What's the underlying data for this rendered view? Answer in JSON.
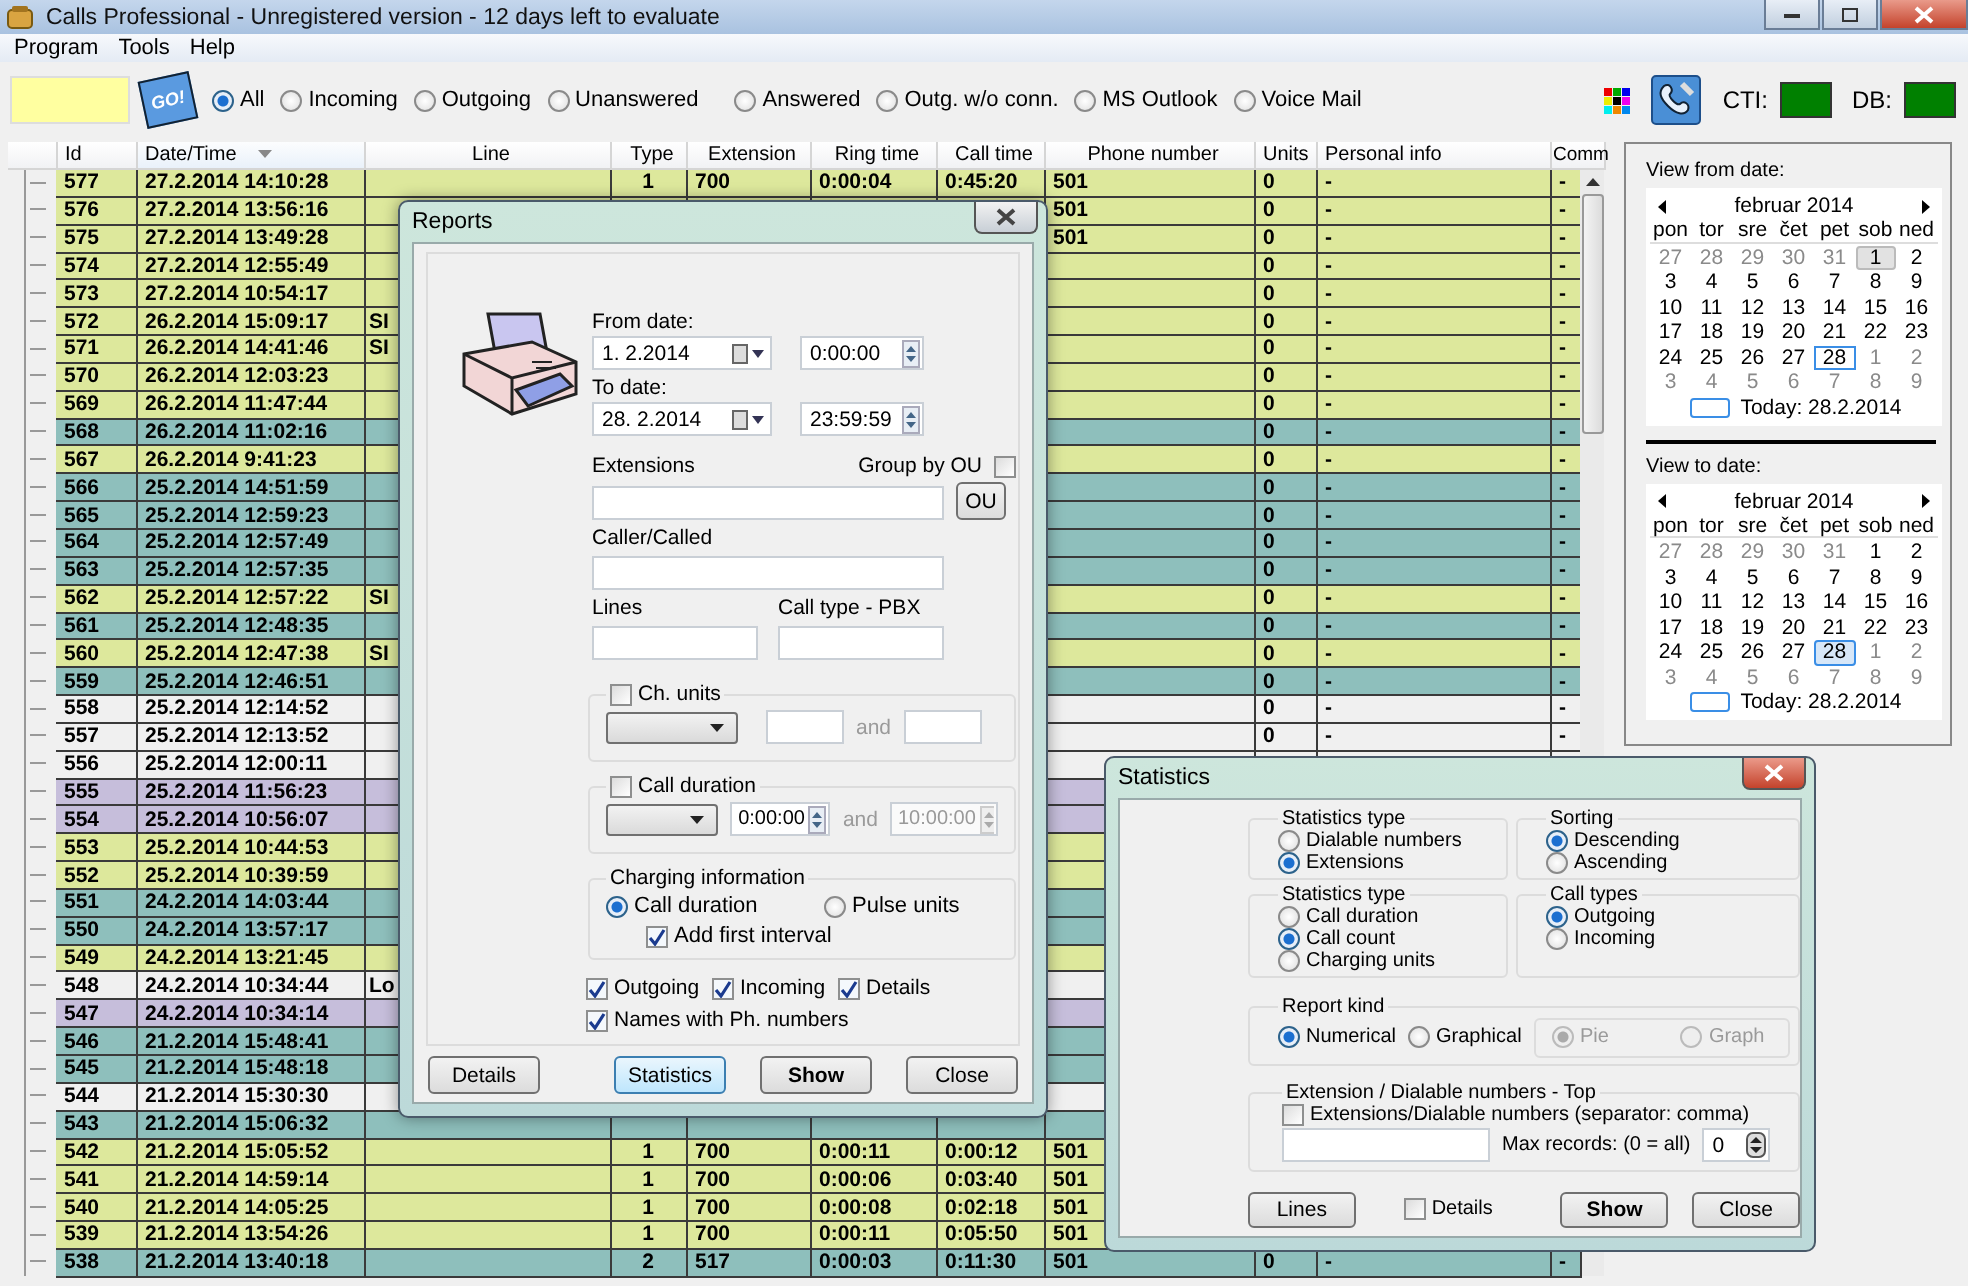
{
  "window": {
    "title": "Calls Professional - Unregistered version - 12 days left to evaluate"
  },
  "menu": [
    "Program",
    "Tools",
    "Help"
  ],
  "toolbar": {
    "go_button": "GO!",
    "filters": [
      {
        "label": "All",
        "selected": true
      },
      {
        "label": "Incoming",
        "selected": false
      },
      {
        "label": "Outgoing",
        "selected": false
      },
      {
        "label": "Unanswered",
        "selected": false
      },
      {
        "label": "Answered",
        "selected": false
      },
      {
        "label": "Outg. w/o conn.",
        "selected": false
      },
      {
        "label": "MS Outlook",
        "selected": false
      },
      {
        "label": "Voice Mail",
        "selected": false
      }
    ],
    "status": [
      {
        "label": "CTI:",
        "color": "#008000"
      },
      {
        "label": "DB:",
        "color": "#008000"
      }
    ]
  },
  "table": {
    "columns": [
      {
        "label": "Id",
        "sorted": false
      },
      {
        "label": "Date/Time",
        "sorted": true
      },
      {
        "label": "Line",
        "sorted": false
      },
      {
        "label": "Type",
        "sorted": false
      },
      {
        "label": "Extension",
        "sorted": false
      },
      {
        "label": "Ring time",
        "sorted": false
      },
      {
        "label": "Call time",
        "sorted": false
      },
      {
        "label": "Phone number",
        "sorted": false
      },
      {
        "label": "Units",
        "sorted": false
      },
      {
        "label": "Personal info",
        "sorted": false
      },
      {
        "label": "Comm",
        "sorted": false
      }
    ],
    "rows": [
      {
        "color": "#dde89c",
        "id": "577",
        "datetime": "27.2.2014 14:10:28",
        "type": "1",
        "extension": "700",
        "ring_time": "0:00:04",
        "call_time": "0:45:20",
        "phone_number": "501",
        "units": "0",
        "personal_info": "-",
        "comment": "-"
      },
      {
        "color": "#dde89c",
        "id": "576",
        "datetime": "27.2.2014 13:56:16",
        "phone_number": "501",
        "units": "0",
        "personal_info": "-",
        "comment": "-"
      },
      {
        "color": "#dde89c",
        "id": "575",
        "datetime": "27.2.2014 13:49:28",
        "phone_number": "501",
        "units": "0",
        "personal_info": "-",
        "comment": "-"
      },
      {
        "color": "#dde89c",
        "id": "574",
        "datetime": "27.2.2014 12:55:49",
        "units": "0",
        "personal_info": "-",
        "comment": "-"
      },
      {
        "color": "#dde89c",
        "id": "573",
        "datetime": "27.2.2014 10:54:17",
        "units": "0",
        "personal_info": "-",
        "comment": "-"
      },
      {
        "color": "#dde89c",
        "id": "572",
        "datetime": "26.2.2014 15:09:17",
        "line": "SI",
        "units": "0",
        "personal_info": "-",
        "comment": "-"
      },
      {
        "color": "#dde89c",
        "id": "571",
        "datetime": "26.2.2014 14:41:46",
        "line": "SI",
        "units": "0",
        "personal_info": "-",
        "comment": "-"
      },
      {
        "color": "#dde89c",
        "id": "570",
        "datetime": "26.2.2014 12:03:23",
        "units": "0",
        "personal_info": "-",
        "comment": "-"
      },
      {
        "color": "#dde89c",
        "id": "569",
        "datetime": "26.2.2014 11:47:44",
        "units": "0",
        "personal_info": "-",
        "comment": "-"
      },
      {
        "color": "#8ebfbc",
        "id": "568",
        "datetime": "26.2.2014 11:02:16",
        "units": "0",
        "personal_info": "-",
        "comment": "-"
      },
      {
        "color": "#dde89c",
        "id": "567",
        "datetime": "26.2.2014 9:41:23",
        "units": "0",
        "personal_info": "-",
        "comment": "-"
      },
      {
        "color": "#8ebfbc",
        "id": "566",
        "datetime": "25.2.2014 14:51:59",
        "units": "0",
        "personal_info": "-",
        "comment": "-"
      },
      {
        "color": "#8ebfbc",
        "id": "565",
        "datetime": "25.2.2014 12:59:23",
        "units": "0",
        "personal_info": "-",
        "comment": "-"
      },
      {
        "color": "#8ebfbc",
        "id": "564",
        "datetime": "25.2.2014 12:57:49",
        "units": "0",
        "personal_info": "-",
        "comment": "-"
      },
      {
        "color": "#8ebfbc",
        "id": "563",
        "datetime": "25.2.2014 12:57:35",
        "units": "0",
        "personal_info": "-",
        "comment": "-"
      },
      {
        "color": "#dde89c",
        "id": "562",
        "datetime": "25.2.2014 12:57:22",
        "line": "SI",
        "units": "0",
        "personal_info": "-",
        "comment": "-"
      },
      {
        "color": "#8ebfbc",
        "id": "561",
        "datetime": "25.2.2014 12:48:35",
        "units": "0",
        "personal_info": "-",
        "comment": "-"
      },
      {
        "color": "#dde89c",
        "id": "560",
        "datetime": "25.2.2014 12:47:38",
        "line": "SI",
        "units": "0",
        "personal_info": "-",
        "comment": "-"
      },
      {
        "color": "#8ebfbc",
        "id": "559",
        "datetime": "25.2.2014 12:46:51",
        "units": "0",
        "personal_info": "-",
        "comment": "-"
      },
      {
        "color": "#f0f0f0",
        "id": "558",
        "datetime": "25.2.2014 12:14:52",
        "units": "0",
        "personal_info": "-",
        "comment": "-"
      },
      {
        "color": "#f0f0f0",
        "id": "557",
        "datetime": "25.2.2014 12:13:52",
        "units": "0",
        "personal_info": "-",
        "comment": "-"
      },
      {
        "color": "#f0f0f0",
        "id": "556",
        "datetime": "25.2.2014 12:00:11"
      },
      {
        "color": "#c6bedb",
        "id": "555",
        "datetime": "25.2.2014 11:56:23"
      },
      {
        "color": "#c6bedb",
        "id": "554",
        "datetime": "25.2.2014 10:56:07"
      },
      {
        "color": "#dde89c",
        "id": "553",
        "datetime": "25.2.2014 10:44:53"
      },
      {
        "color": "#dde89c",
        "id": "552",
        "datetime": "25.2.2014 10:39:59"
      },
      {
        "color": "#8ebfbc",
        "id": "551",
        "datetime": "24.2.2014 14:03:44"
      },
      {
        "color": "#8ebfbc",
        "id": "550",
        "datetime": "24.2.2014 13:57:17"
      },
      {
        "color": "#dde89c",
        "id": "549",
        "datetime": "24.2.2014 13:21:45"
      },
      {
        "color": "#f0f0f0",
        "id": "548",
        "datetime": "24.2.2014 10:34:44",
        "line": "Lo"
      },
      {
        "color": "#c6bedb",
        "id": "547",
        "datetime": "24.2.2014 10:34:14"
      },
      {
        "color": "#8ebfbc",
        "id": "546",
        "datetime": "21.2.2014 15:48:41"
      },
      {
        "color": "#8ebfbc",
        "id": "545",
        "datetime": "21.2.2014 15:48:18"
      },
      {
        "color": "#f0f0f0",
        "id": "544",
        "datetime": "21.2.2014 15:30:30"
      },
      {
        "color": "#8ebfbc",
        "id": "543",
        "datetime": "21.2.2014 15:06:32"
      },
      {
        "color": "#dde89c",
        "id": "542",
        "datetime": "21.2.2014 15:05:52",
        "type": "1",
        "extension": "700",
        "ring_time": "0:00:11",
        "call_time": "0:00:12",
        "phone_number": "501"
      },
      {
        "color": "#dde89c",
        "id": "541",
        "datetime": "21.2.2014 14:59:14",
        "type": "1",
        "extension": "700",
        "ring_time": "0:00:06",
        "call_time": "0:03:40",
        "phone_number": "501"
      },
      {
        "color": "#dde89c",
        "id": "540",
        "datetime": "21.2.2014 14:05:25",
        "type": "1",
        "extension": "700",
        "ring_time": "0:00:08",
        "call_time": "0:02:18",
        "phone_number": "501"
      },
      {
        "color": "#dde89c",
        "id": "539",
        "datetime": "21.2.2014 13:54:26",
        "type": "1",
        "extension": "700",
        "ring_time": "0:00:11",
        "call_time": "0:05:50",
        "phone_number": "501"
      },
      {
        "color": "#8ebfbc",
        "id": "538",
        "datetime": "21.2.2014 13:40:18",
        "type": "2",
        "extension": "517",
        "ring_time": "0:00:03",
        "call_time": "0:11:30",
        "phone_number": "501",
        "units": "0",
        "personal_info": "-",
        "comment": "-"
      }
    ]
  },
  "calendars": [
    {
      "title": "View from date:",
      "month": "februar 2014",
      "weekdays": [
        "pon",
        "tor",
        "sre",
        "čet",
        "pet",
        "sob",
        "ned"
      ],
      "today_label": "Today: 28.2.2014",
      "weeks": [
        [
          {
            "day": "27",
            "outside": true,
            "selected": false,
            "today": false
          },
          {
            "day": "28",
            "outside": true,
            "selected": false,
            "today": false
          },
          {
            "day": "29",
            "outside": true,
            "selected": false,
            "today": false
          },
          {
            "day": "30",
            "outside": true,
            "selected": false,
            "today": false
          },
          {
            "day": "31",
            "outside": true,
            "selected": false,
            "today": false
          },
          {
            "day": "1",
            "outside": false,
            "selected": true,
            "today": false
          },
          {
            "day": "2",
            "outside": false,
            "selected": false,
            "today": false
          }
        ],
        [
          {
            "day": "3",
            "outside": false,
            "selected": false,
            "today": false
          },
          {
            "day": "4",
            "outside": false,
            "selected": false,
            "today": false
          },
          {
            "day": "5",
            "outside": false,
            "selected": false,
            "today": false
          },
          {
            "day": "6",
            "outside": false,
            "selected": false,
            "today": false
          },
          {
            "day": "7",
            "outside": false,
            "selected": false,
            "today": false
          },
          {
            "day": "8",
            "outside": false,
            "selected": false,
            "today": false
          },
          {
            "day": "9",
            "outside": false,
            "selected": false,
            "today": false
          }
        ],
        [
          {
            "day": "10",
            "outside": false,
            "selected": false,
            "today": false
          },
          {
            "day": "11",
            "outside": false,
            "selected": false,
            "today": false
          },
          {
            "day": "12",
            "outside": false,
            "selected": false,
            "today": false
          },
          {
            "day": "13",
            "outside": false,
            "selected": false,
            "today": false
          },
          {
            "day": "14",
            "outside": false,
            "selected": false,
            "today": false
          },
          {
            "day": "15",
            "outside": false,
            "selected": false,
            "today": false
          },
          {
            "day": "16",
            "outside": false,
            "selected": false,
            "today": false
          }
        ],
        [
          {
            "day": "17",
            "outside": false,
            "selected": false,
            "today": false
          },
          {
            "day": "18",
            "outside": false,
            "selected": false,
            "today": false
          },
          {
            "day": "19",
            "outside": false,
            "selected": false,
            "today": false
          },
          {
            "day": "20",
            "outside": false,
            "selected": false,
            "today": false
          },
          {
            "day": "21",
            "outside": false,
            "selected": false,
            "today": false
          },
          {
            "day": "22",
            "outside": false,
            "selected": false,
            "today": false
          },
          {
            "day": "23",
            "outside": false,
            "selected": false,
            "today": false
          }
        ],
        [
          {
            "day": "24",
            "outside": false,
            "selected": false,
            "today": false
          },
          {
            "day": "25",
            "outside": false,
            "selected": false,
            "today": false
          },
          {
            "day": "26",
            "outside": false,
            "selected": false,
            "today": false
          },
          {
            "day": "27",
            "outside": false,
            "selected": false,
            "today": false
          },
          {
            "day": "28",
            "outside": false,
            "selected": false,
            "today": true
          },
          {
            "day": "1",
            "outside": true,
            "selected": false,
            "today": false
          },
          {
            "day": "2",
            "outside": true,
            "selected": false,
            "today": false
          }
        ],
        [
          {
            "day": "3",
            "outside": true,
            "selected": false,
            "today": false
          },
          {
            "day": "4",
            "outside": true,
            "selected": false,
            "today": false
          },
          {
            "day": "5",
            "outside": true,
            "selected": false,
            "today": false
          },
          {
            "day": "6",
            "outside": true,
            "selected": false,
            "today": false
          },
          {
            "day": "7",
            "outside": true,
            "selected": false,
            "today": false
          },
          {
            "day": "8",
            "outside": true,
            "selected": false,
            "today": false
          },
          {
            "day": "9",
            "outside": true,
            "selected": false,
            "today": false
          }
        ]
      ]
    },
    {
      "title": "View to date:",
      "month": "februar 2014",
      "weekdays": [
        "pon",
        "tor",
        "sre",
        "čet",
        "pet",
        "sob",
        "ned"
      ],
      "today_label": "Today: 28.2.2014",
      "weeks": [
        [
          {
            "day": "27",
            "outside": true,
            "selected": false,
            "today": false
          },
          {
            "day": "28",
            "outside": true,
            "selected": false,
            "today": false
          },
          {
            "day": "29",
            "outside": true,
            "selected": false,
            "today": false
          },
          {
            "day": "30",
            "outside": true,
            "selected": false,
            "today": false
          },
          {
            "day": "31",
            "outside": true,
            "selected": false,
            "today": false
          },
          {
            "day": "1",
            "outside": false,
            "selected": false,
            "today": false
          },
          {
            "day": "2",
            "outside": false,
            "selected": false,
            "today": false
          }
        ],
        [
          {
            "day": "3",
            "outside": false,
            "selected": false,
            "today": false
          },
          {
            "day": "4",
            "outside": false,
            "selected": false,
            "today": false
          },
          {
            "day": "5",
            "outside": false,
            "selected": false,
            "today": false
          },
          {
            "day": "6",
            "outside": false,
            "selected": false,
            "today": false
          },
          {
            "day": "7",
            "outside": false,
            "selected": false,
            "today": false
          },
          {
            "day": "8",
            "outside": false,
            "selected": false,
            "today": false
          },
          {
            "day": "9",
            "outside": false,
            "selected": false,
            "today": false
          }
        ],
        [
          {
            "day": "10",
            "outside": false,
            "selected": false,
            "today": false
          },
          {
            "day": "11",
            "outside": false,
            "selected": false,
            "today": false
          },
          {
            "day": "12",
            "outside": false,
            "selected": false,
            "today": false
          },
          {
            "day": "13",
            "outside": false,
            "selected": false,
            "today": false
          },
          {
            "day": "14",
            "outside": false,
            "selected": false,
            "today": false
          },
          {
            "day": "15",
            "outside": false,
            "selected": false,
            "today": false
          },
          {
            "day": "16",
            "outside": false,
            "selected": false,
            "today": false
          }
        ],
        [
          {
            "day": "17",
            "outside": false,
            "selected": false,
            "today": false
          },
          {
            "day": "18",
            "outside": false,
            "selected": false,
            "today": false
          },
          {
            "day": "19",
            "outside": false,
            "selected": false,
            "today": false
          },
          {
            "day": "20",
            "outside": false,
            "selected": false,
            "today": false
          },
          {
            "day": "21",
            "outside": false,
            "selected": false,
            "today": false
          },
          {
            "day": "22",
            "outside": false,
            "selected": false,
            "today": false
          },
          {
            "day": "23",
            "outside": false,
            "selected": false,
            "today": false
          }
        ],
        [
          {
            "day": "24",
            "outside": false,
            "selected": false,
            "today": false
          },
          {
            "day": "25",
            "outside": false,
            "selected": false,
            "today": false
          },
          {
            "day": "26",
            "outside": false,
            "selected": false,
            "today": false
          },
          {
            "day": "27",
            "outside": false,
            "selected": false,
            "today": false
          },
          {
            "day": "28",
            "outside": false,
            "selected": true,
            "today": true
          },
          {
            "day": "1",
            "outside": true,
            "selected": false,
            "today": false
          },
          {
            "day": "2",
            "outside": true,
            "selected": false,
            "today": false
          }
        ],
        [
          {
            "day": "3",
            "outside": true,
            "selected": false,
            "today": false
          },
          {
            "day": "4",
            "outside": true,
            "selected": false,
            "today": false
          },
          {
            "day": "5",
            "outside": true,
            "selected": false,
            "today": false
          },
          {
            "day": "6",
            "outside": true,
            "selected": false,
            "today": false
          },
          {
            "day": "7",
            "outside": true,
            "selected": false,
            "today": false
          },
          {
            "day": "8",
            "outside": true,
            "selected": false,
            "today": false
          },
          {
            "day": "9",
            "outside": true,
            "selected": false,
            "today": false
          }
        ]
      ]
    }
  ],
  "reports": {
    "title": "Reports",
    "from_label": "From date:",
    "from_date": "1.  2.2014",
    "from_time": "0:00:00",
    "to_label": "To date:",
    "to_date": "28.  2.2014",
    "to_time": "23:59:59",
    "extensions_label": "Extensions",
    "group_by_ou": {
      "label": "Group by OU",
      "checked": false
    },
    "ou_button": "OU",
    "caller_label": "Caller/Called",
    "lines_label": "Lines",
    "call_type_label": "Call type - PBX",
    "ch_units": {
      "label": "Ch. units",
      "checked": false,
      "and": "and"
    },
    "call_duration": {
      "label": "Call duration",
      "checked": false,
      "from": "0:00:00",
      "and": "and",
      "to": "10:00:00"
    },
    "charging": {
      "label": "Charging information",
      "options": [
        {
          "label": "Call duration",
          "selected": true
        },
        {
          "label": "Pulse units",
          "selected": false
        }
      ],
      "add_first_interval": {
        "label": "Add first interval",
        "checked": true
      }
    },
    "checks": [
      {
        "label": "Outgoing",
        "checked": true
      },
      {
        "label": "Incoming",
        "checked": true
      },
      {
        "label": "Details",
        "checked": true
      },
      {
        "label": "Names with Ph. numbers",
        "checked": true
      }
    ],
    "buttons": [
      {
        "label": "Details",
        "kind": "normal"
      },
      {
        "label": "Statistics",
        "kind": "focused"
      },
      {
        "label": "Show",
        "kind": "default"
      },
      {
        "label": "Close",
        "kind": "normal"
      }
    ]
  },
  "statistics": {
    "title": "Statistics",
    "groups": [
      {
        "label": "Statistics type",
        "options": [
          {
            "label": "Dialable numbers",
            "selected": false
          },
          {
            "label": "Extensions",
            "selected": true
          }
        ]
      },
      {
        "label": "Sorting",
        "options": [
          {
            "label": "Descending",
            "selected": true
          },
          {
            "label": "Ascending",
            "selected": false
          }
        ]
      },
      {
        "label": "Statistics type",
        "options": [
          {
            "label": "Call duration",
            "selected": false
          },
          {
            "label": "Call count",
            "selected": true
          },
          {
            "label": "Charging units",
            "selected": false
          }
        ]
      },
      {
        "label": "Call types",
        "options": [
          {
            "label": "Outgoing",
            "selected": true
          },
          {
            "label": "Incoming",
            "selected": false
          }
        ]
      }
    ],
    "report_kind": {
      "label": "Report kind",
      "options": [
        {
          "label": "Numerical",
          "selected": true,
          "disabled": false
        },
        {
          "label": "Graphical",
          "selected": false,
          "disabled": false
        }
      ],
      "sub_options": [
        {
          "label": "Pie",
          "selected": true,
          "disabled": true
        },
        {
          "label": "Graph",
          "selected": false,
          "disabled": true
        }
      ]
    },
    "top": {
      "label": "Extension / Dialable numbers - Top",
      "checkbox": {
        "label": "Extensions/Dialable numbers (separator: comma)",
        "checked": false
      },
      "max_label": "Max records: (0 = all)",
      "max_value": "0"
    },
    "buttons": [
      {
        "label": "Lines",
        "kind": "normal"
      },
      {
        "label": "Show",
        "kind": "default"
      },
      {
        "label": "Close",
        "kind": "normal"
      }
    ],
    "details": {
      "label": "Details",
      "checked": false
    }
  }
}
